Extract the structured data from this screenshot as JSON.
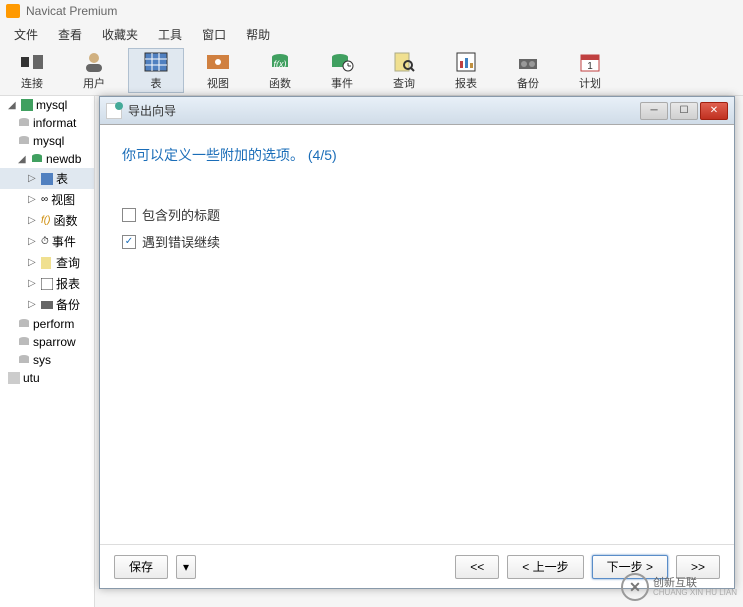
{
  "app": {
    "title": "Navicat Premium"
  },
  "menubar": {
    "items": [
      "文件",
      "查看",
      "收藏夹",
      "工具",
      "窗口",
      "帮助"
    ]
  },
  "toolbar": {
    "items": [
      {
        "label": "连接",
        "icon": "plug"
      },
      {
        "label": "用户",
        "icon": "user"
      },
      {
        "label": "表",
        "icon": "table"
      },
      {
        "label": "视图",
        "icon": "view"
      },
      {
        "label": "函数",
        "icon": "func"
      },
      {
        "label": "事件",
        "icon": "event"
      },
      {
        "label": "查询",
        "icon": "query"
      },
      {
        "label": "报表",
        "icon": "report"
      },
      {
        "label": "备份",
        "icon": "backup"
      },
      {
        "label": "计划",
        "icon": "schedule"
      }
    ]
  },
  "sidebar": {
    "items": [
      {
        "label": "mysql",
        "level": 1,
        "icon": "server",
        "expanded": true
      },
      {
        "label": "informat",
        "level": 2,
        "icon": "db-gray"
      },
      {
        "label": "mysql",
        "level": 2,
        "icon": "db-gray"
      },
      {
        "label": "newdb",
        "level": 2,
        "icon": "db-green",
        "expanded": true
      },
      {
        "label": "表",
        "level": 3,
        "icon": "table",
        "selected": true,
        "hasExpand": true
      },
      {
        "label": "视图",
        "level": 3,
        "icon": "view",
        "hasExpand": true
      },
      {
        "label": "函数",
        "level": 3,
        "icon": "func",
        "hasExpand": true
      },
      {
        "label": "事件",
        "level": 3,
        "icon": "event",
        "hasExpand": true
      },
      {
        "label": "查询",
        "level": 3,
        "icon": "query",
        "hasExpand": true
      },
      {
        "label": "报表",
        "level": 3,
        "icon": "report",
        "hasExpand": true
      },
      {
        "label": "备份",
        "level": 3,
        "icon": "backup",
        "hasExpand": true
      },
      {
        "label": "perform",
        "level": 2,
        "icon": "db-gray"
      },
      {
        "label": "sparrow",
        "level": 2,
        "icon": "db-gray"
      },
      {
        "label": "sys",
        "level": 2,
        "icon": "db-gray"
      },
      {
        "label": "utu",
        "level": 1,
        "icon": "server-gray"
      }
    ]
  },
  "dialog": {
    "title": "导出向导",
    "prompt": "你可以定义一些附加的选项。 (4/5)",
    "checkboxes": [
      {
        "label": "包含列的标题",
        "checked": false
      },
      {
        "label": "遇到错误继续",
        "checked": true
      }
    ],
    "footer": {
      "save": "保存",
      "first": "<<",
      "prev": "< 上一步",
      "next": "下一步 >",
      "last": ">>"
    }
  },
  "watermark": {
    "brand": "创新互联",
    "sub": "CHUANG XIN HU LIAN"
  }
}
